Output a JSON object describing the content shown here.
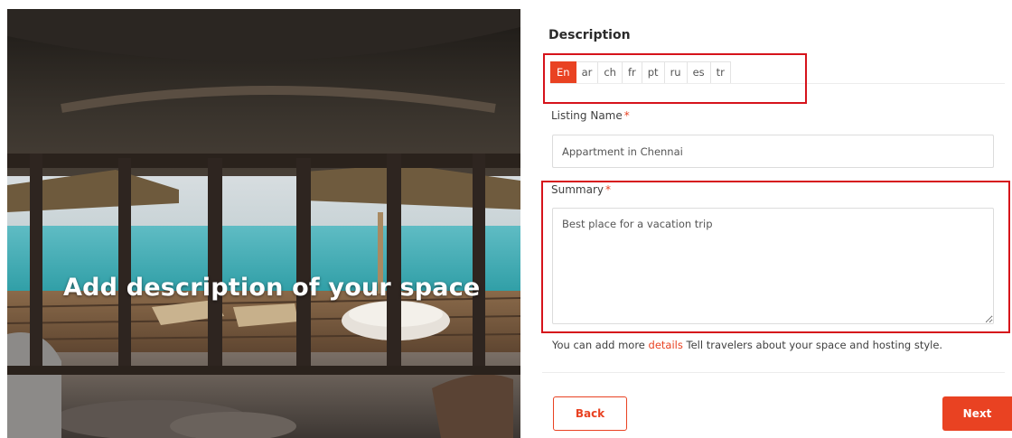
{
  "hero": {
    "title": "Add description of your space"
  },
  "form": {
    "section_title": "Description",
    "language_tabs": [
      {
        "label": "En",
        "active": true
      },
      {
        "label": "ar",
        "active": false
      },
      {
        "label": "ch",
        "active": false
      },
      {
        "label": "fr",
        "active": false
      },
      {
        "label": "pt",
        "active": false
      },
      {
        "label": "ru",
        "active": false
      },
      {
        "label": "es",
        "active": false
      },
      {
        "label": "tr",
        "active": false
      }
    ],
    "listing_name": {
      "label": "Listing Name",
      "required_mark": "*",
      "value": "Appartment in Chennai"
    },
    "summary": {
      "label": "Summary",
      "required_mark": "*",
      "value": "Best place for a vacation trip"
    },
    "help": {
      "prefix": "You can add more",
      "link": "details",
      "suffix": "Tell travelers about your space and hosting style."
    },
    "back_label": "Back",
    "next_label": "Next"
  },
  "colors": {
    "accent": "#e94222",
    "highlight": "#d6131b"
  }
}
